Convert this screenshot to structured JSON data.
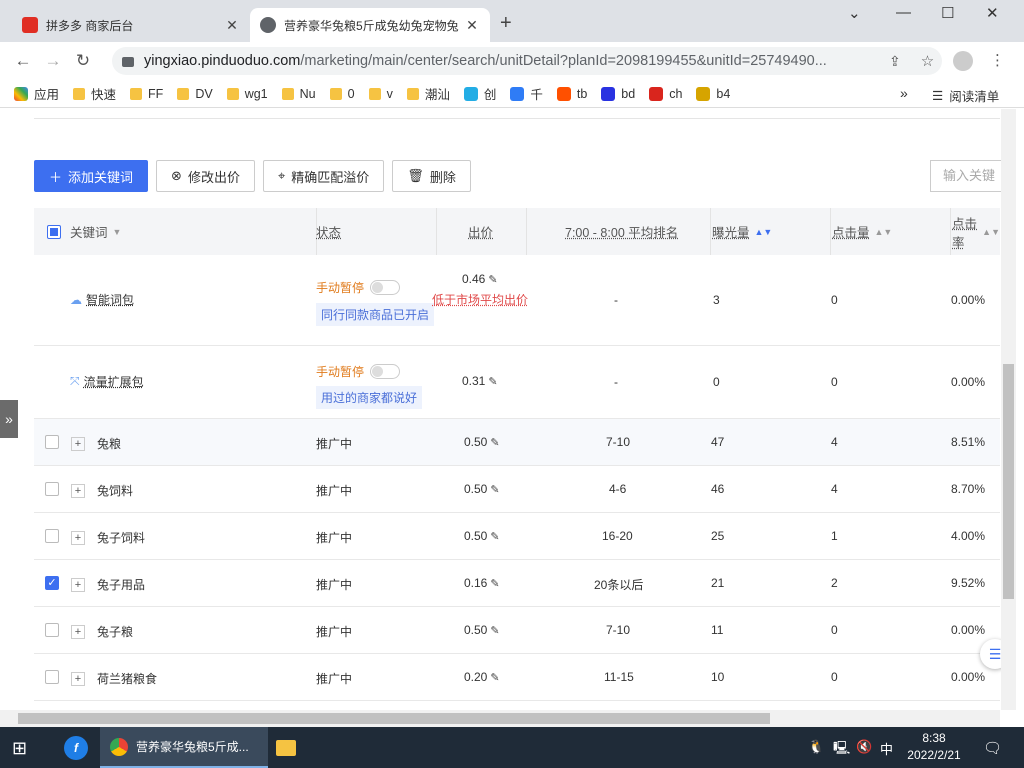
{
  "browser": {
    "tabs": [
      {
        "title": "拼多多 商家后台",
        "active": false
      },
      {
        "title": "营养豪华兔粮5斤成兔幼兔宠物兔",
        "active": true
      }
    ],
    "new_tab": "+",
    "url_host": "yingxiao.pinduoduo.com",
    "url_path": "/marketing/main/center/search/unitDetail?planId=2098199455&unitId=25749490...",
    "bookmarks": [
      {
        "label": "应用",
        "icon": "apps-icon"
      },
      {
        "label": "快速",
        "icon": "folder-icon"
      },
      {
        "label": "FF",
        "icon": "folder-icon"
      },
      {
        "label": "DV",
        "icon": "folder-icon"
      },
      {
        "label": "wg1",
        "icon": "folder-icon"
      },
      {
        "label": "Nu",
        "icon": "folder-icon"
      },
      {
        "label": "0",
        "icon": "folder-icon"
      },
      {
        "label": "v",
        "icon": "folder-icon"
      },
      {
        "label": "潮汕",
        "icon": "folder-icon"
      },
      {
        "label": "创",
        "icon": "bilibili-icon"
      },
      {
        "label": "千",
        "icon": "qianniu-icon"
      },
      {
        "label": "tb",
        "icon": "taobao-icon"
      },
      {
        "label": "bd",
        "icon": "baidu-icon"
      },
      {
        "label": "ch",
        "icon": "ch-icon"
      },
      {
        "label": "b4",
        "icon": "b4-icon"
      }
    ],
    "more": "»",
    "reading_list": "阅读清单"
  },
  "toolbar": {
    "add_keyword": "添加关键词",
    "modify_bid": "修改出价",
    "exact_match": "精确匹配溢价",
    "delete": "删除",
    "keyword_input_placeholder": "输入关键"
  },
  "table": {
    "headers": {
      "keyword": "关键词",
      "status": "状态",
      "bid": "出价",
      "avg_rank": "7:00 - 8:00 平均排名",
      "impressions": "曝光量",
      "clicks": "点击量",
      "ctr": "点击率"
    },
    "special_rows": [
      {
        "name": "智能词包",
        "status": "手动暂停",
        "note": "同行同款商品已开启",
        "bid": "0.46",
        "bid_warning": "低于市场平均出价",
        "rank": "-",
        "impressions": "3",
        "clicks": "0",
        "ctr": "0.00%"
      },
      {
        "name": "流量扩展包",
        "status": "手动暂停",
        "note": "用过的商家都说好",
        "bid": "0.31",
        "rank": "-",
        "impressions": "0",
        "clicks": "0",
        "ctr": "0.00%"
      }
    ],
    "rows": [
      {
        "keyword": "兔粮",
        "status": "推广中",
        "bid": "0.50",
        "rank": "7-10",
        "impressions": "47",
        "clicks": "4",
        "ctr": "8.51%",
        "checked": false
      },
      {
        "keyword": "兔饲料",
        "status": "推广中",
        "bid": "0.50",
        "rank": "4-6",
        "impressions": "46",
        "clicks": "4",
        "ctr": "8.70%",
        "checked": false
      },
      {
        "keyword": "兔子饲料",
        "status": "推广中",
        "bid": "0.50",
        "rank": "16-20",
        "impressions": "25",
        "clicks": "1",
        "ctr": "4.00%",
        "checked": false
      },
      {
        "keyword": "兔子用品",
        "status": "推广中",
        "bid": "0.16",
        "rank": "20条以后",
        "impressions": "21",
        "clicks": "2",
        "ctr": "9.52%",
        "checked": true
      },
      {
        "keyword": "兔子粮",
        "status": "推广中",
        "bid": "0.50",
        "rank": "7-10",
        "impressions": "11",
        "clicks": "0",
        "ctr": "0.00%",
        "checked": false
      },
      {
        "keyword": "荷兰猪粮食",
        "status": "推广中",
        "bid": "0.20",
        "rank": "11-15",
        "impressions": "10",
        "clicks": "0",
        "ctr": "0.00%",
        "checked": false
      }
    ]
  },
  "side_tab": "»",
  "taskbar": {
    "chrome_title": "营养豪华兔粮5斤成...",
    "ime": "中",
    "time": "8:38",
    "date": "2022/2/21"
  },
  "colors": {
    "primary": "#3d6ff0",
    "orange": "#e07b1c",
    "red": "#e04848"
  }
}
